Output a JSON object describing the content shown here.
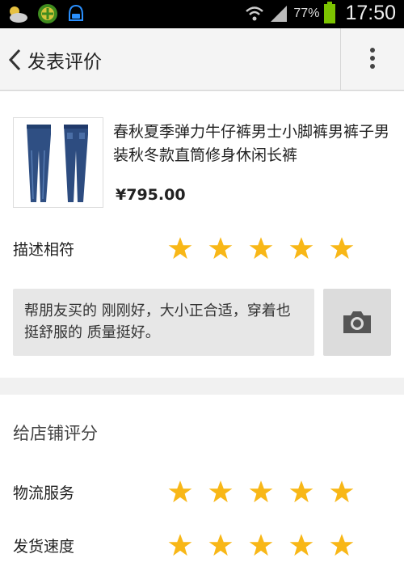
{
  "status_bar": {
    "battery_percent": "77%",
    "time": "17:50",
    "icons": [
      "weather-icon",
      "app-update-icon",
      "notification-icon",
      "wifi-icon",
      "signal-icon",
      "battery-icon"
    ]
  },
  "app_bar": {
    "title": "发表评价",
    "back_icon": "chevron-left-icon",
    "menu_icon": "more-vertical-icon"
  },
  "product": {
    "name": "春秋夏季弹力牛仔裤男士小脚裤男裤子男装秋冬款直筒修身休闲长裤",
    "price": "¥795.00",
    "image": "jeans-thumbnail"
  },
  "description_rating": {
    "label": "描述相符",
    "stars": 5,
    "max": 5
  },
  "comment": {
    "text": "帮朋友买的   刚刚好，大小正合适，穿着也挺舒服的  质量挺好。",
    "camera_icon": "camera-icon"
  },
  "shop_rating": {
    "section_title": "给店铺评分",
    "items": [
      {
        "label": "物流服务",
        "stars": 5,
        "max": 5
      },
      {
        "label": "发货速度",
        "stars": 5,
        "max": 5
      }
    ]
  },
  "colors": {
    "star": "#f8b717",
    "status_bar": "#000000",
    "battery": "#7cc400"
  }
}
